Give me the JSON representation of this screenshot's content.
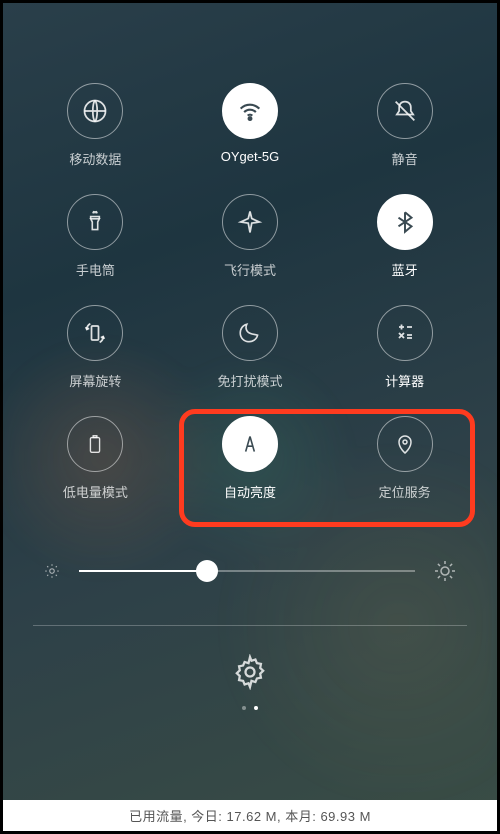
{
  "tiles": [
    {
      "id": "mobile-data",
      "label": "移动数据",
      "active": false
    },
    {
      "id": "wifi",
      "label": "OYget-5G",
      "active": true
    },
    {
      "id": "silent",
      "label": "静音",
      "active": false
    },
    {
      "id": "flashlight",
      "label": "手电筒",
      "active": false
    },
    {
      "id": "airplane",
      "label": "飞行模式",
      "active": false
    },
    {
      "id": "bluetooth",
      "label": "蓝牙",
      "active": true
    },
    {
      "id": "rotation",
      "label": "屏幕旋转",
      "active": false
    },
    {
      "id": "dnd",
      "label": "免打扰模式",
      "active": false
    },
    {
      "id": "calculator",
      "label": "计算器",
      "active": false
    },
    {
      "id": "battery-saver",
      "label": "低电量模式",
      "active": false
    },
    {
      "id": "auto-brightness",
      "label": "自动亮度",
      "active": true
    },
    {
      "id": "location",
      "label": "定位服务",
      "active": false
    }
  ],
  "brightness": {
    "percent": 38
  },
  "pagination": {
    "count": 2,
    "current": 2
  },
  "status": {
    "prefix": "已用流量, 今日: ",
    "today": "17.62 M",
    "mid": ", 本月: ",
    "month": "69.93 M"
  }
}
